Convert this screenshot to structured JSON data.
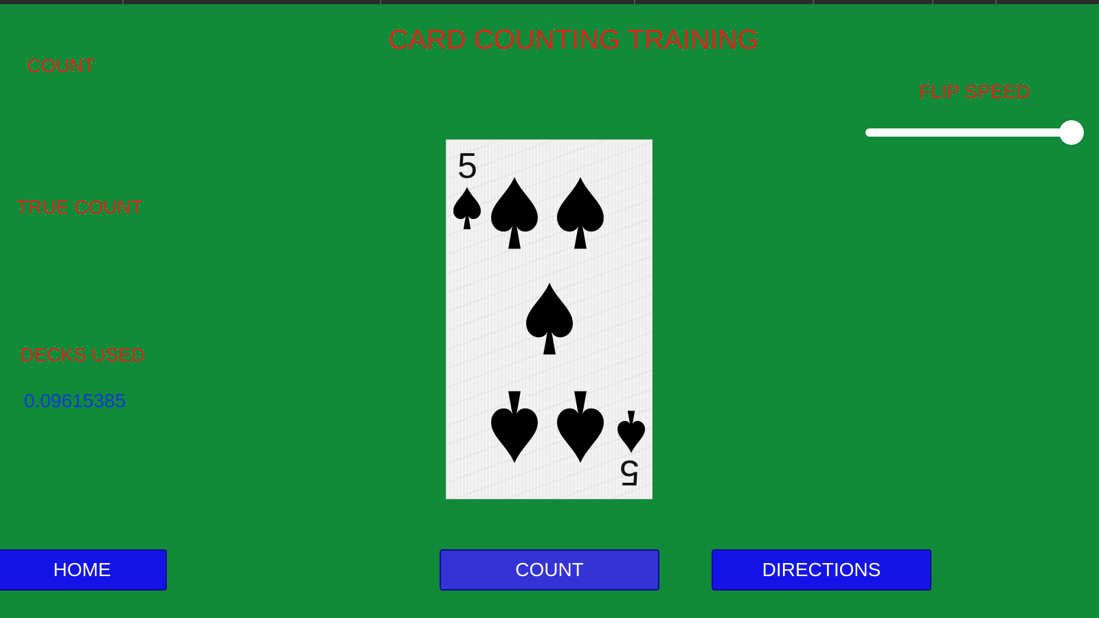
{
  "app": {
    "title": "CARD COUNTING TRAINING"
  },
  "stats": {
    "count_label": "COUNT",
    "true_count_label": "TRUE COUNT",
    "decks_used_label": "DECKS USED",
    "decks_used_value": "0.09615385"
  },
  "speed": {
    "label": "FLIP SPEED",
    "value_fraction": 1.0
  },
  "card": {
    "rank": "5",
    "suit": "spade-icon"
  },
  "buttons": {
    "home": "HOME",
    "count": "COUNT",
    "directions": "DIRECTIONS"
  },
  "colors": {
    "table_green": "#118a3a",
    "label_red": "#e2231a",
    "value_blue": "#1239d6",
    "button_blue": "#1414e6"
  }
}
